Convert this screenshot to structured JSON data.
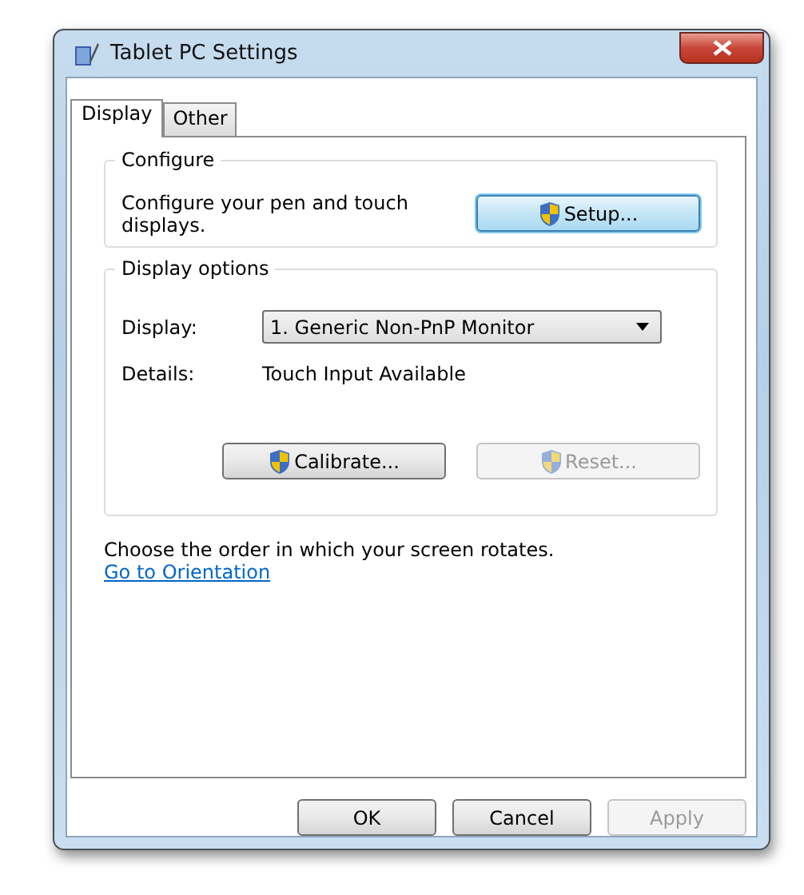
{
  "window": {
    "title": "Tablet PC Settings"
  },
  "tabs": [
    {
      "label": "Display",
      "selected": true
    },
    {
      "label": "Other",
      "selected": false
    }
  ],
  "configure": {
    "title": "Configure",
    "description": "Configure your pen and touch displays.",
    "button": {
      "label": "Setup...",
      "disabled": false
    }
  },
  "display_options": {
    "title": "Display options",
    "display_label": "Display:",
    "display_value": "1. Generic Non-PnP Monitor",
    "details_label": "Details:",
    "details_value": "Touch Input Available",
    "buttons": [
      {
        "label": "Calibrate...",
        "disabled": false
      },
      {
        "label": "Reset...",
        "disabled": true
      }
    ]
  },
  "orientation": {
    "text": "Choose the order in which your screen rotates.",
    "link": "Go to Orientation"
  },
  "footer_buttons": [
    {
      "label": "OK",
      "disabled": false
    },
    {
      "label": "Cancel",
      "disabled": false
    },
    {
      "label": "Apply",
      "disabled": true
    }
  ]
}
